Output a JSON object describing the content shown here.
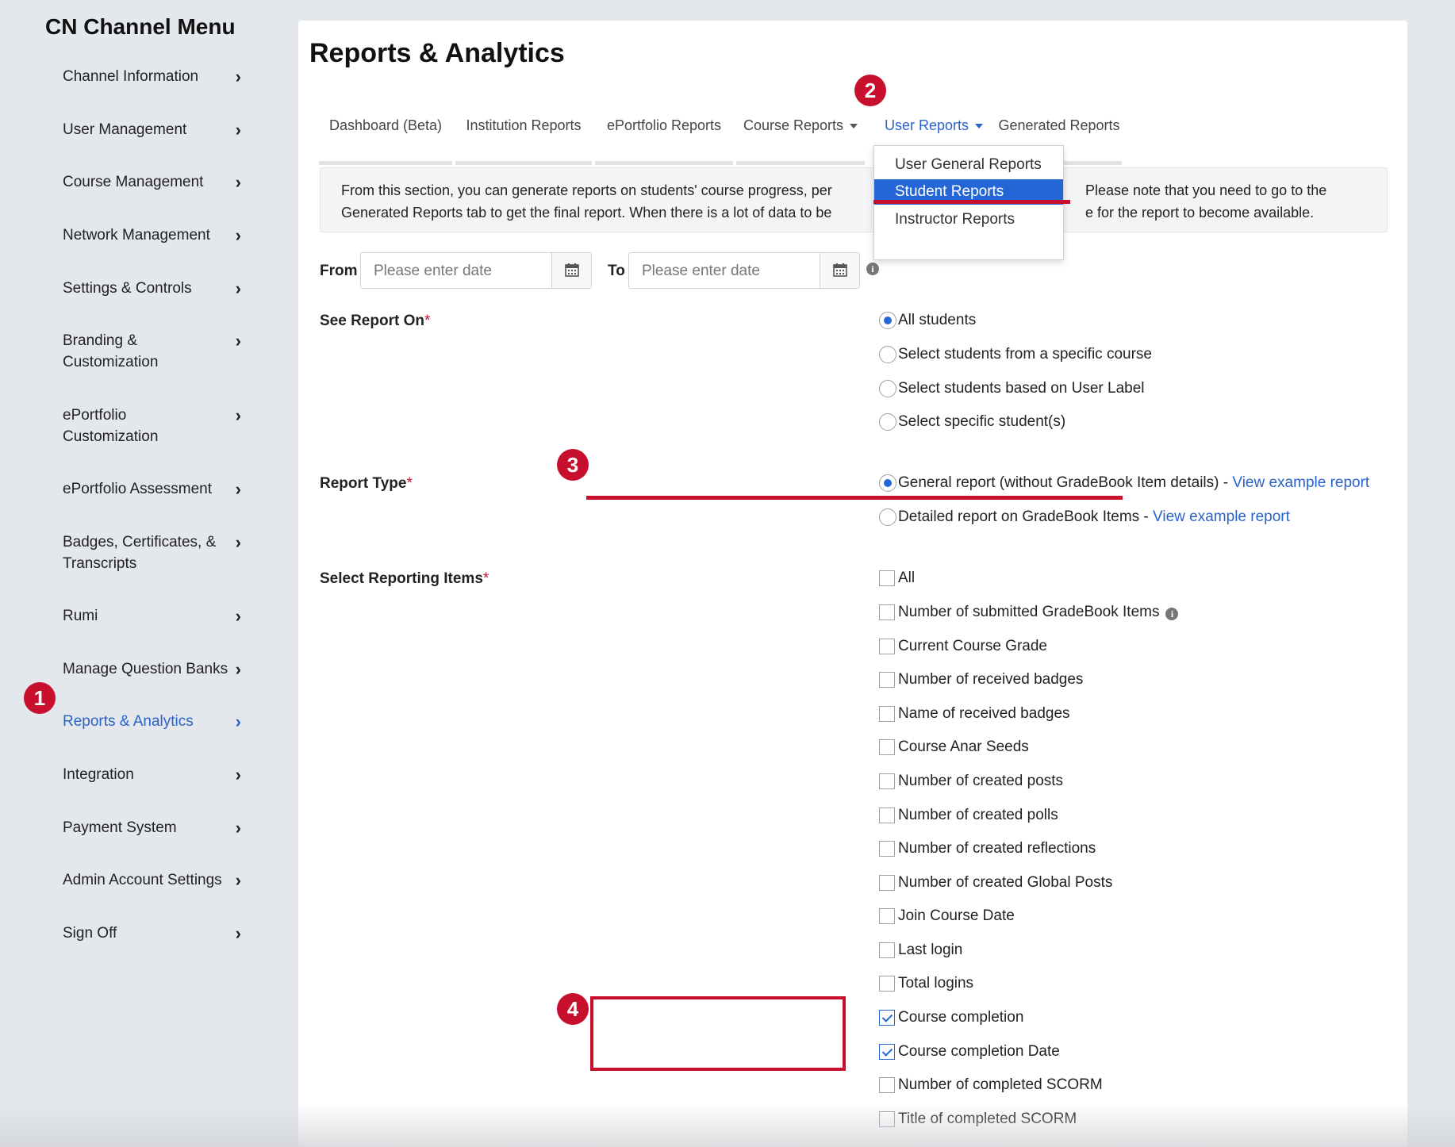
{
  "sidebar": {
    "title": "CN Channel Menu",
    "items": [
      {
        "label": "Channel Information"
      },
      {
        "label": "User Management"
      },
      {
        "label": "Course Management"
      },
      {
        "label": "Network Management"
      },
      {
        "label": "Settings & Controls"
      },
      {
        "label": "Branding & Customization"
      },
      {
        "label": "ePortfolio Customization"
      },
      {
        "label": "ePortfolio Assessment"
      },
      {
        "label": "Badges, Certificates, & Transcripts"
      },
      {
        "label": "Rumi"
      },
      {
        "label": "Manage Question Banks"
      },
      {
        "label": "Reports & Analytics"
      },
      {
        "label": "Integration"
      },
      {
        "label": "Payment System"
      },
      {
        "label": "Admin Account Settings"
      },
      {
        "label": "Sign Off"
      }
    ],
    "active_item": "Reports & Analytics"
  },
  "badges": {
    "one": "1",
    "two": "2",
    "three": "3",
    "four": "4"
  },
  "main": {
    "title": "Reports & Analytics",
    "tabs": [
      {
        "label": "Dashboard (Beta)"
      },
      {
        "label": "Institution Reports"
      },
      {
        "label": "ePortfolio Reports"
      },
      {
        "label": "Course Reports"
      },
      {
        "label": "User Reports"
      },
      {
        "label": "Generated Reports"
      }
    ],
    "active_tab": "User Reports",
    "dropdown": {
      "items": [
        {
          "label": "User General Reports"
        },
        {
          "label": "Student Reports"
        },
        {
          "label": "Instructor Reports"
        }
      ],
      "selected": "Student Reports"
    },
    "info_line1": "From this section, you can generate reports on students' course progress, per",
    "info_line1_end": "Please note that you need to go to the",
    "info_line2": "Generated Reports tab to get the final report. When there is a lot of data to be",
    "info_line2_end": "e for the report to become available.",
    "from_label": "From",
    "to_label": "To",
    "date_placeholder": "Please enter date",
    "see_report_on": {
      "label": "See Report On",
      "options": [
        "All students",
        "Select students from a specific course",
        "Select students based on User Label",
        "Select specific student(s)"
      ],
      "selected": "All students"
    },
    "report_type": {
      "label": "Report Type",
      "options": [
        {
          "text": "General report (without GradeBook Item details) - ",
          "link": "View example report"
        },
        {
          "text": "Detailed report on GradeBook Items - ",
          "link": "View example report"
        }
      ],
      "selected": "General report (without GradeBook Item details)"
    },
    "reporting_items": {
      "label": "Select Reporting Items",
      "items": [
        {
          "label": "All",
          "checked": false
        },
        {
          "label": "Number of submitted GradeBook Items",
          "checked": false
        },
        {
          "label": "Current Course Grade",
          "checked": false
        },
        {
          "label": "Number of received badges",
          "checked": false
        },
        {
          "label": "Name of received badges",
          "checked": false
        },
        {
          "label": "Course Anar Seeds",
          "checked": false
        },
        {
          "label": "Number of created posts",
          "checked": false
        },
        {
          "label": "Number of created polls",
          "checked": false
        },
        {
          "label": "Number of created reflections",
          "checked": false
        },
        {
          "label": "Number of created Global Posts",
          "checked": false
        },
        {
          "label": "Join Course Date",
          "checked": false
        },
        {
          "label": "Last login",
          "checked": false
        },
        {
          "label": "Total logins",
          "checked": false
        },
        {
          "label": "Course completion",
          "checked": true
        },
        {
          "label": "Course completion Date",
          "checked": true
        },
        {
          "label": "Number of completed SCORM",
          "checked": false
        },
        {
          "label": "Title of completed SCORM",
          "checked": false
        }
      ]
    },
    "required_mark": "*"
  },
  "colors": {
    "accent": "#2566d6",
    "annotation": "#c8102e"
  }
}
